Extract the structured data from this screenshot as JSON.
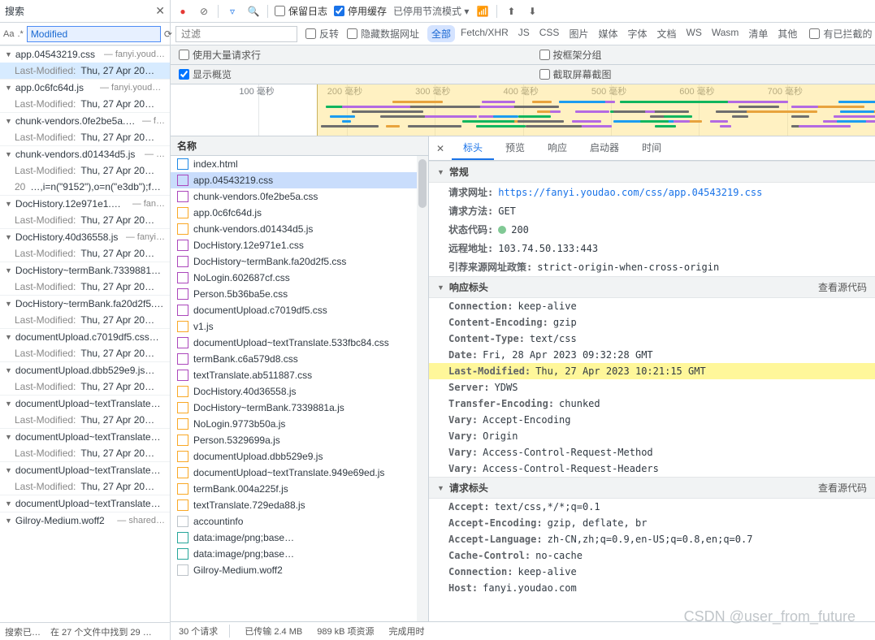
{
  "search": {
    "title": "搜索",
    "aa": "Aa",
    "regex": ".*",
    "input_value": "Modified",
    "refresh_icon": "⟳",
    "clear_icon": "⊘",
    "close_icon": "✕",
    "footer_label": "搜索已…",
    "footer_status": "在 27 个文件中找到 29 …",
    "results": [
      {
        "file": "app.04543219.css",
        "src": "fanyi.youd…",
        "lines": [
          {
            "ln": "Last-Modified:",
            "txt": "Thu, 27 Apr 20…",
            "sel": true
          }
        ]
      },
      {
        "file": "app.0c6fc64d.js",
        "src": "fanyi.youdao…",
        "lines": [
          {
            "ln": "Last-Modified:",
            "txt": "Thu, 27 Apr 20…"
          }
        ]
      },
      {
        "file": "chunk-vendors.0fe2be5a.css",
        "src": "f…",
        "lines": [
          {
            "ln": "Last-Modified:",
            "txt": "Thu, 27 Apr 20…"
          }
        ]
      },
      {
        "file": "chunk-vendors.d01434d5.js",
        "src": "…",
        "lines": [
          {
            "ln": "Last-Modified:",
            "txt": "Thu, 27 Apr 20…"
          },
          {
            "ln": "20",
            "txt": "…,i=n(\"9152\"),o=n(\"e3db\");f…"
          }
        ]
      },
      {
        "file": "DocHistory.12e971e1.css",
        "src": "fan…",
        "lines": [
          {
            "ln": "Last-Modified:",
            "txt": "Thu, 27 Apr 20…"
          }
        ]
      },
      {
        "file": "DocHistory.40d36558.js",
        "src": "fanyi…",
        "lines": [
          {
            "ln": "Last-Modified:",
            "txt": "Thu, 27 Apr 20…"
          }
        ]
      },
      {
        "file": "DocHistory~termBank.7339881a…",
        "src": "",
        "lines": [
          {
            "ln": "Last-Modified:",
            "txt": "Thu, 27 Apr 20…"
          }
        ]
      },
      {
        "file": "DocHistory~termBank.fa20d2f5.…",
        "src": "",
        "lines": [
          {
            "ln": "Last-Modified:",
            "txt": "Thu, 27 Apr 20…"
          }
        ]
      },
      {
        "file": "documentUpload.c7019df5.css…",
        "src": "",
        "lines": [
          {
            "ln": "Last-Modified:",
            "txt": "Thu, 27 Apr 20…"
          }
        ]
      },
      {
        "file": "documentUpload.dbb529e9.js…",
        "src": "",
        "lines": [
          {
            "ln": "Last-Modified:",
            "txt": "Thu, 27 Apr 20…"
          }
        ]
      },
      {
        "file": "documentUpload~textTranslate…",
        "src": "",
        "lines": [
          {
            "ln": "Last-Modified:",
            "txt": "Thu, 27 Apr 20…"
          }
        ]
      },
      {
        "file": "documentUpload~textTranslate…",
        "src": "",
        "lines": [
          {
            "ln": "Last-Modified:",
            "txt": "Thu, 27 Apr 20…"
          }
        ]
      },
      {
        "file": "documentUpload~textTranslate…",
        "src": "",
        "lines": [
          {
            "ln": "Last-Modified:",
            "txt": "Thu, 27 Apr 20…"
          }
        ]
      },
      {
        "file": "documentUpload~textTranslate…",
        "src": "",
        "lines": []
      },
      {
        "file": "Gilroy-Medium.woff2",
        "src": "shared…",
        "lines": []
      }
    ]
  },
  "network": {
    "toolbar": {
      "preserve_log": "保留日志",
      "disable_cache": "停用缓存",
      "throttling": "已停用节流模式"
    },
    "filterbar": {
      "placeholder": "过滤",
      "invert": "反转",
      "hide_data_urls": "隐藏数据网址",
      "types": [
        "全部",
        "Fetch/XHR",
        "JS",
        "CSS",
        "图片",
        "媒体",
        "字体",
        "文档",
        "WS",
        "Wasm",
        "清单",
        "其他"
      ],
      "active_type": "全部",
      "blocked_cookies": "有已拦截的 Coo"
    },
    "options": {
      "big_rows": "使用大量请求行",
      "group_by_frame": "按框架分组",
      "overview": "显示概览",
      "screenshots": "截取屏幕截图"
    },
    "overview_ticks": [
      "100 毫秒",
      "200 毫秒",
      "300 毫秒",
      "400 毫秒",
      "500 毫秒",
      "600 毫秒",
      "700 毫秒"
    ],
    "name_header": "名称",
    "requests": [
      {
        "name": "index.html",
        "type": "html"
      },
      {
        "name": "app.04543219.css",
        "type": "css",
        "sel": true
      },
      {
        "name": "chunk-vendors.0fe2be5a.css",
        "type": "css"
      },
      {
        "name": "app.0c6fc64d.js",
        "type": "js"
      },
      {
        "name": "chunk-vendors.d01434d5.js",
        "type": "js"
      },
      {
        "name": "DocHistory.12e971e1.css",
        "type": "css"
      },
      {
        "name": "DocHistory~termBank.fa20d2f5.css",
        "type": "css"
      },
      {
        "name": "NoLogin.602687cf.css",
        "type": "css"
      },
      {
        "name": "Person.5b36ba5e.css",
        "type": "css"
      },
      {
        "name": "documentUpload.c7019df5.css",
        "type": "css"
      },
      {
        "name": "v1.js",
        "type": "js"
      },
      {
        "name": "documentUpload~textTranslate.533fbc84.css",
        "type": "css"
      },
      {
        "name": "termBank.c6a579d8.css",
        "type": "css"
      },
      {
        "name": "textTranslate.ab511887.css",
        "type": "css"
      },
      {
        "name": "DocHistory.40d36558.js",
        "type": "js"
      },
      {
        "name": "DocHistory~termBank.7339881a.js",
        "type": "js"
      },
      {
        "name": "NoLogin.9773b50a.js",
        "type": "js"
      },
      {
        "name": "Person.5329699a.js",
        "type": "js"
      },
      {
        "name": "documentUpload.dbb529e9.js",
        "type": "js"
      },
      {
        "name": "documentUpload~textTranslate.949e69ed.js",
        "type": "js"
      },
      {
        "name": "termBank.004a225f.js",
        "type": "js"
      },
      {
        "name": "textTranslate.729eda88.js",
        "type": "js"
      },
      {
        "name": "accountinfo",
        "type": "gen"
      },
      {
        "name": "data:image/png;base…",
        "type": "img"
      },
      {
        "name": "data:image/png;base…",
        "type": "img"
      },
      {
        "name": "Gilroy-Medium.woff2",
        "type": "gen"
      }
    ],
    "status": {
      "count": "30 个请求",
      "transferred": "已传输 2.4 MB",
      "resources": "989 kB 项资源",
      "finish": "完成用时"
    },
    "detail": {
      "tabs": [
        "标头",
        "预览",
        "响应",
        "启动器",
        "时间"
      ],
      "active_tab": "标头",
      "general_label": "常规",
      "general": [
        {
          "k": "请求网址:",
          "v": "https://fanyi.youdao.com/css/app.04543219.css",
          "link": true
        },
        {
          "k": "请求方法:",
          "v": "GET"
        },
        {
          "k": "状态代码:",
          "v": "200",
          "status": true
        },
        {
          "k": "远程地址:",
          "v": "103.74.50.133:443"
        },
        {
          "k": "引荐来源网址政策:",
          "v": "strict-origin-when-cross-origin"
        }
      ],
      "resp_label": "响应标头",
      "view_source": "查看源代码",
      "resp": [
        {
          "k": "Connection:",
          "v": "keep-alive"
        },
        {
          "k": "Content-Encoding:",
          "v": "gzip"
        },
        {
          "k": "Content-Type:",
          "v": "text/css"
        },
        {
          "k": "Date:",
          "v": "Fri, 28 Apr 2023 09:32:28 GMT"
        },
        {
          "k": "Last-Modified:",
          "v": "Thu, 27 Apr 2023 10:21:15 GMT",
          "hilite": true
        },
        {
          "k": "Server:",
          "v": "YDWS"
        },
        {
          "k": "Transfer-Encoding:",
          "v": "chunked"
        },
        {
          "k": "Vary:",
          "v": "Accept-Encoding"
        },
        {
          "k": "Vary:",
          "v": "Origin"
        },
        {
          "k": "Vary:",
          "v": "Access-Control-Request-Method"
        },
        {
          "k": "Vary:",
          "v": "Access-Control-Request-Headers"
        }
      ],
      "req_label": "请求标头",
      "req": [
        {
          "k": "Accept:",
          "v": "text/css,*/*;q=0.1"
        },
        {
          "k": "Accept-Encoding:",
          "v": "gzip, deflate, br"
        },
        {
          "k": "Accept-Language:",
          "v": "zh-CN,zh;q=0.9,en-US;q=0.8,en;q=0.7"
        },
        {
          "k": "Cache-Control:",
          "v": "no-cache"
        },
        {
          "k": "Connection:",
          "v": "keep-alive"
        },
        {
          "k": "Host:",
          "v": "fanyi.youdao.com"
        }
      ]
    }
  },
  "watermark": "CSDN @user_from_future"
}
